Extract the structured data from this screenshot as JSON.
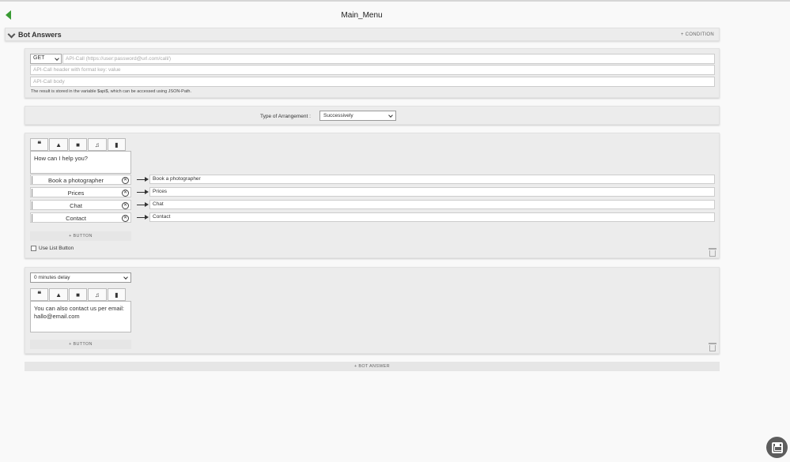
{
  "header": {
    "title": "Main_Menu"
  },
  "section": {
    "title": "Bot Answers",
    "condition_label": "+ CONDITION"
  },
  "api": {
    "method": "GET",
    "url_placeholder": "API-Call (https://user:password@url.com/call/)",
    "header_placeholder": "API-Call header with format key: value",
    "body_placeholder": "API-Call body",
    "note": "The result is stored in the variable $api$, which can be accessed using JSON-Path."
  },
  "arrangement": {
    "label": "Type of Arrangement :",
    "value": "Successively"
  },
  "message1": {
    "text": "How can I help you?",
    "buttons": [
      {
        "label": "Book a photographer",
        "target": "Book a photographer"
      },
      {
        "label": "Prices",
        "target": "Prices"
      },
      {
        "label": "Chat",
        "target": "Chat"
      },
      {
        "label": "Contact",
        "target": "Contact"
      }
    ],
    "add_button_label": "+ BUTTON",
    "use_list_label": "Use List Button"
  },
  "message2": {
    "delay": "0 minutes delay",
    "text_line1": "You can also contact us per email:",
    "text_line2": "hallo@email.com",
    "add_button_label": "+ BUTTON"
  },
  "toolbar": {
    "quote_glyph": "❝",
    "image_glyph": "▲",
    "video_glyph": "■",
    "audio_glyph": "♫",
    "file_glyph": "▮"
  },
  "footer": {
    "add_bot_answer_label": "+ BOT ANSWER"
  },
  "colors": {
    "accent": "#3a9b34",
    "card_bg": "#ececec",
    "fab": "#5d5d5d"
  }
}
